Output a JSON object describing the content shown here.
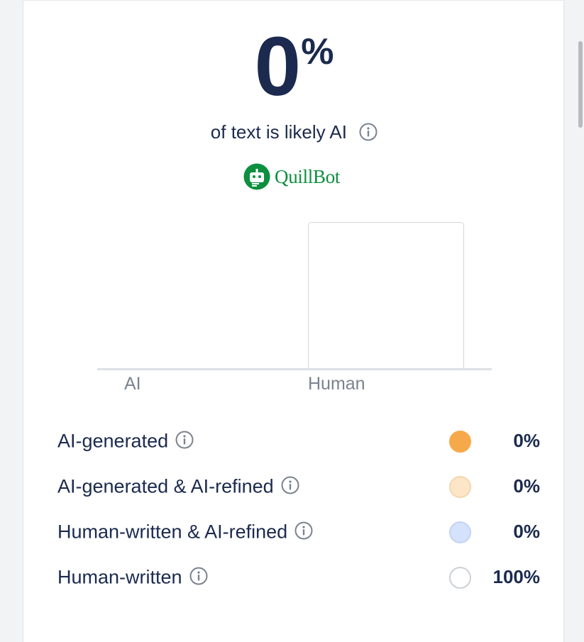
{
  "score": {
    "number": "0",
    "percent_sign": "%",
    "subtitle": "of text is likely AI",
    "value_fraction": 0
  },
  "brand": {
    "name": "QuillBot",
    "color": "#0d8f3f"
  },
  "chart_data": {
    "type": "bar",
    "categories": [
      "AI",
      "Human"
    ],
    "values": [
      0,
      100
    ],
    "ylim": [
      0,
      100
    ],
    "legend": "none",
    "grid": false
  },
  "legend": {
    "items": [
      {
        "label": "AI-generated",
        "value": "0%",
        "color": "#f6a94b",
        "border": "#f6a94b"
      },
      {
        "label": "AI-generated & AI-refined",
        "value": "0%",
        "color": "#fde5c7",
        "border": "#f3d6b0"
      },
      {
        "label": "Human-written & AI-refined",
        "value": "0%",
        "color": "#d4e2fb",
        "border": "#c3d4f2"
      },
      {
        "label": "Human-written",
        "value": "100%",
        "color": "#ffffff",
        "border": "#cdd1d8"
      }
    ]
  },
  "colors": {
    "text_primary": "#1b2a4e",
    "text_muted": "#7b8290",
    "icon_gray": "#7b8290"
  },
  "icons": [
    "info-icon",
    "quillbot-logo-icon"
  ]
}
